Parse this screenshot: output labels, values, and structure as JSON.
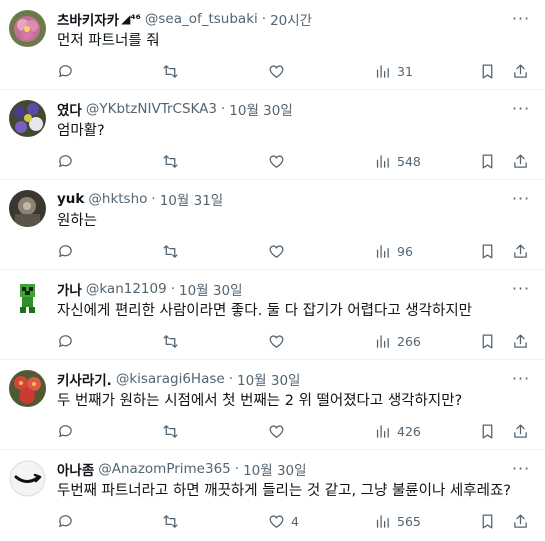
{
  "tweets": [
    {
      "name": "츠바키자카",
      "name_suffix": "◢⁴⁶",
      "handle": "@sea_of_tsubaki",
      "sep": "·",
      "time": "20시간",
      "text": "먼저 파트너를 줘",
      "reply_count": "",
      "retweet_count": "",
      "like_count": "",
      "views": "31",
      "avatar": "pink-flower"
    },
    {
      "name": "였다",
      "name_suffix": "",
      "handle": "@YKbtzNIVTrCSKA3",
      "sep": "·",
      "time": "10월 30일",
      "text": "엄마활?",
      "reply_count": "",
      "retweet_count": "",
      "like_count": "",
      "views": "548",
      "avatar": "purple-flowers"
    },
    {
      "name": "yuk",
      "name_suffix": "",
      "handle": "@hktsho",
      "sep": "·",
      "time": "10월 31일",
      "text": "원하는",
      "reply_count": "",
      "retweet_count": "",
      "like_count": "",
      "views": "96",
      "avatar": "dark-photo"
    },
    {
      "name": "가나",
      "name_suffix": "",
      "handle": "@kan12109",
      "sep": "·",
      "time": "10월 30일",
      "text": "자신에게 편리한 사람이라면 좋다. 둘 다 잡기가 어렵다고 생각하지만",
      "reply_count": "",
      "retweet_count": "",
      "like_count": "",
      "views": "266",
      "avatar": "green-pixel-creeper"
    },
    {
      "name": "키사라기.",
      "name_suffix": "",
      "handle": "@kisaragi6Hase",
      "sep": "·",
      "time": "10월 30일",
      "text": "두 번째가 원하는 시점에서 첫 번째는 2 위 떨어졌다고 생각하지만?",
      "reply_count": "",
      "retweet_count": "",
      "like_count": "",
      "views": "426",
      "avatar": "red-flowers"
    },
    {
      "name": "아나좀",
      "name_suffix": "",
      "handle": "@AnazomPrime365",
      "sep": "·",
      "time": "10월 30일",
      "text": "두번째 파트너라고 하면 깨끗하게 들리는 것 같고, 그냥 불륜이나 세후레죠?",
      "reply_count": "",
      "retweet_count": "",
      "like_count": "4",
      "views": "565",
      "avatar": "amazon-smile"
    }
  ],
  "more_glyph": "···",
  "colors": {
    "secondary": "#536471",
    "primary": "#0f1419",
    "divider": "#eff3f4"
  }
}
